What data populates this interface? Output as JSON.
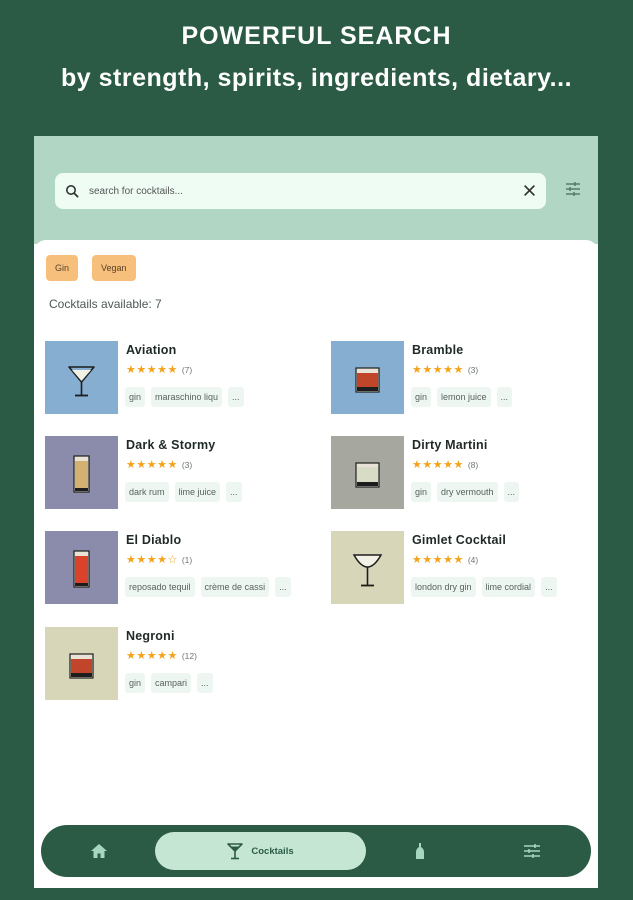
{
  "promo": {
    "line1": "POWERFUL SEARCH",
    "line2": "by strength, spirits, ingredients, dietary..."
  },
  "search": {
    "placeholder": "search for cocktails..."
  },
  "filters": [
    {
      "label": "Gin"
    },
    {
      "label": "Vegan"
    }
  ],
  "count_label": "Cocktails available: 7",
  "cocktails": [
    {
      "name": "Aviation",
      "stars": "★★★★★",
      "rating_count": "(7)",
      "tags": [
        "gin",
        "maraschino liqu",
        "..."
      ],
      "thumb_color": "#86aed0",
      "glass": "martini"
    },
    {
      "name": "Bramble",
      "stars": "★★★★★",
      "rating_count": "(3)",
      "tags": [
        "gin",
        "lemon juice",
        "..."
      ],
      "thumb_color": "#86aed0",
      "glass": "rocks"
    },
    {
      "name": "Dark & Stormy",
      "stars": "★★★★★",
      "rating_count": "(3)",
      "tags": [
        "dark rum",
        "lime juice",
        "..."
      ],
      "thumb_color": "#8b8bab",
      "glass": "highball"
    },
    {
      "name": "Dirty Martini",
      "stars": "★★★★★",
      "rating_count": "(8)",
      "tags": [
        "gin",
        "dry vermouth",
        "..."
      ],
      "thumb_color": "#a6a8a0",
      "glass": "rocks-clear"
    },
    {
      "name": "El Diablo",
      "stars": "★★★★☆",
      "rating_count": "(1)",
      "tags": [
        "reposado tequil",
        "crème de cassi",
        "..."
      ],
      "thumb_color": "#8b8bab",
      "glass": "highball-red"
    },
    {
      "name": "Gimlet Cocktail",
      "stars": "★★★★★",
      "rating_count": "(4)",
      "tags": [
        "london dry gin",
        "lime cordial",
        "..."
      ],
      "thumb_color": "#d8d6b8",
      "glass": "coupe"
    },
    {
      "name": "Negroni",
      "stars": "★★★★★",
      "rating_count": "(12)",
      "tags": [
        "gin",
        "campari",
        "..."
      ],
      "thumb_color": "#d8d6b8",
      "glass": "rocks"
    }
  ],
  "nav": {
    "cocktails_label": "Cocktails"
  },
  "colors": {
    "brand_green": "#2b5b45",
    "chip_orange": "#f7bf7c",
    "star_orange": "#f2a31a",
    "mint": "#b2d6c4"
  }
}
